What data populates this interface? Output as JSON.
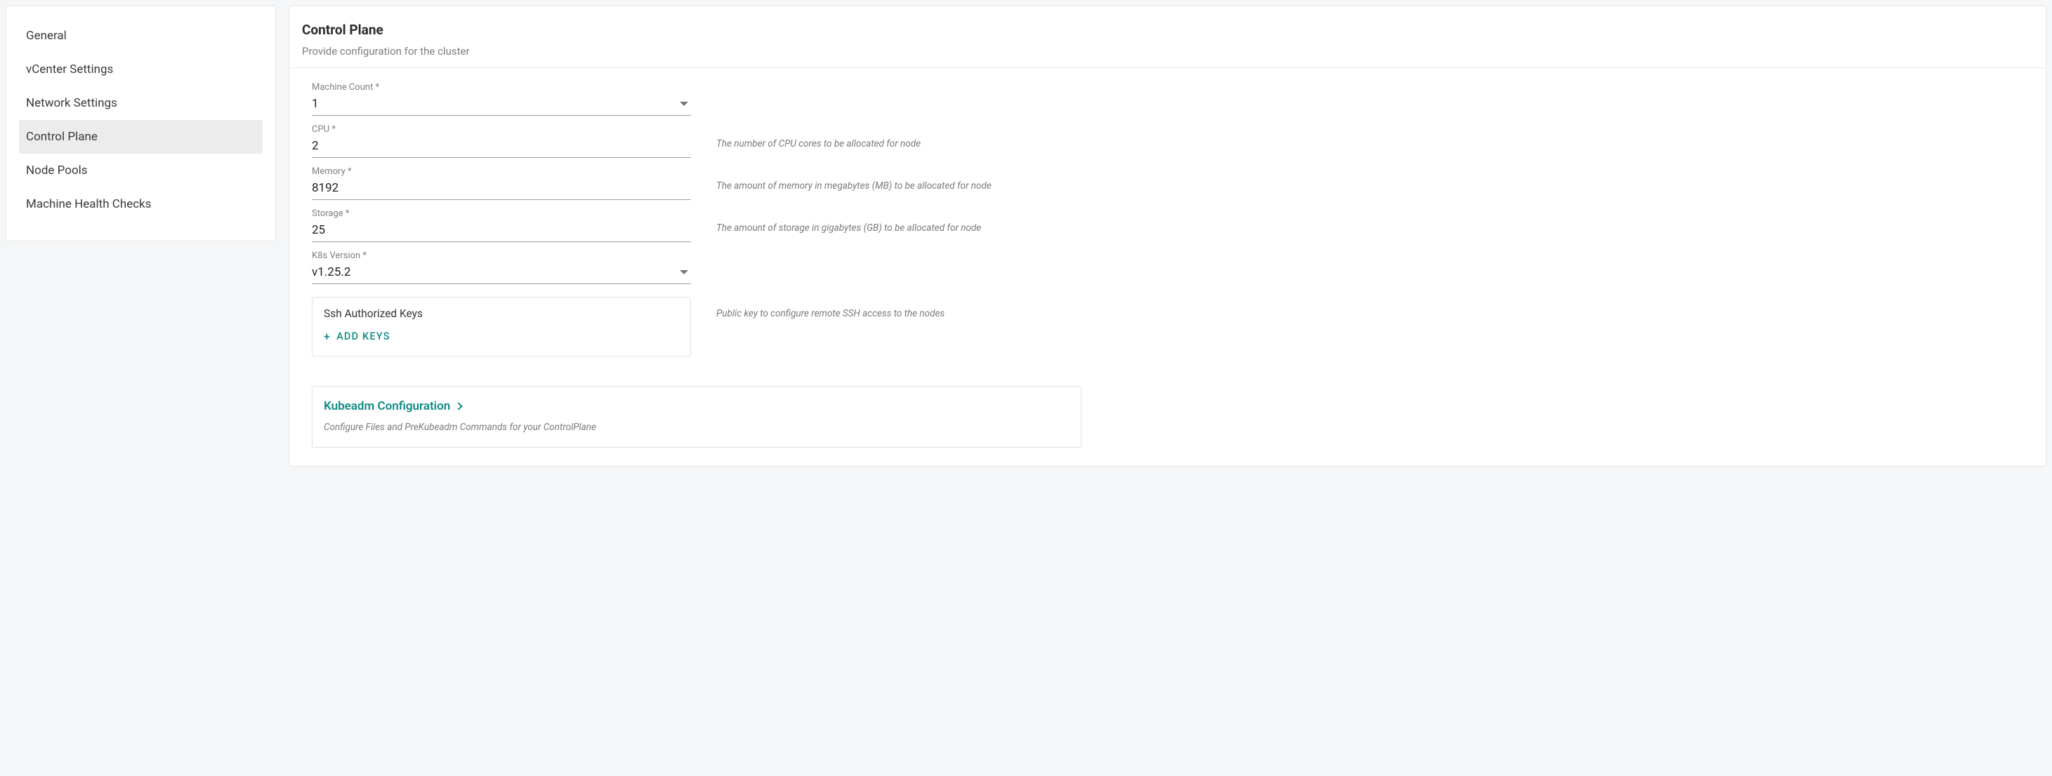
{
  "sidebar": {
    "items": [
      {
        "label": "General",
        "active": false
      },
      {
        "label": "vCenter Settings",
        "active": false
      },
      {
        "label": "Network Settings",
        "active": false
      },
      {
        "label": "Control Plane",
        "active": true
      },
      {
        "label": "Node Pools",
        "active": false
      },
      {
        "label": "Machine Health Checks",
        "active": false
      }
    ]
  },
  "header": {
    "title": "Control Plane",
    "subtitle": "Provide configuration for the cluster"
  },
  "fields": {
    "machineCount": {
      "label": "Machine Count *",
      "value": "1"
    },
    "cpu": {
      "label": "CPU *",
      "value": "2",
      "hint": "The number of CPU cores to be allocated for node"
    },
    "memory": {
      "label": "Memory *",
      "value": "8192",
      "hint": "The amount of memory in megabytes (MB) to be allocated for node"
    },
    "storage": {
      "label": "Storage *",
      "value": "25",
      "hint": "The amount of storage in gigabytes (GB) to be allocated for node"
    },
    "k8sVersion": {
      "label": "K8s Version *",
      "value": "v1.25.2"
    }
  },
  "ssh": {
    "title": "Ssh Authorized Keys",
    "addLabel": "Add  Keys",
    "hint": "Public key to configure remote SSH access to the nodes"
  },
  "kubeadm": {
    "title": "Kubeadm Configuration",
    "desc": "Configure Files and PreKubeadm Commands for your ControlPlane"
  }
}
